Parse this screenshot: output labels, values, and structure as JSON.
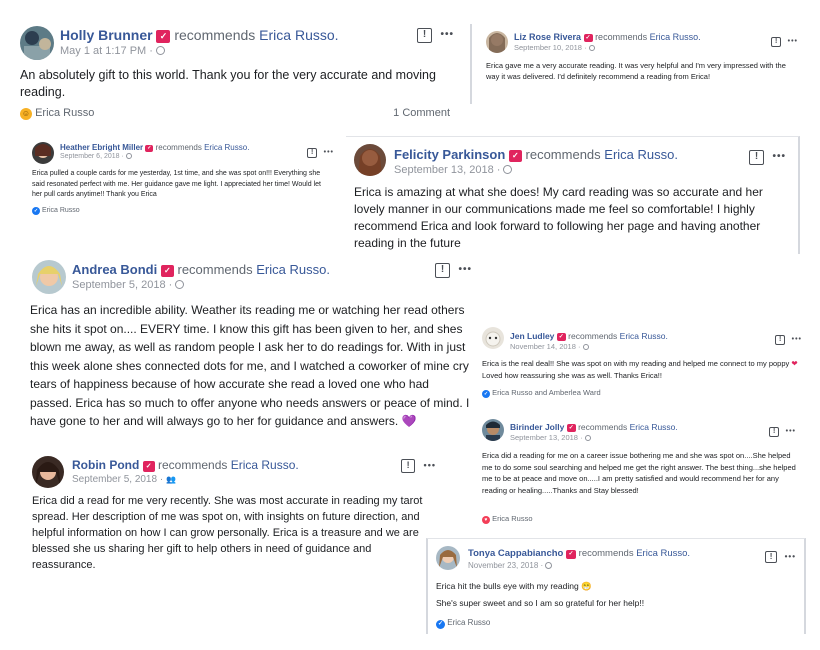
{
  "common": {
    "recommends": "recommends",
    "page_name": "Erica Russo.",
    "badge_icon": "recommendation-badge-icon",
    "flag_glyph": "!",
    "more_glyph": "•••",
    "dot": "·"
  },
  "reviews": {
    "holly": {
      "name": "Holly Brunner",
      "date": "May 1 at 1:17 PM",
      "text": "An absolutely gift to this world. Thank you for the very accurate and moving reading.",
      "reactors": "Erica Russo",
      "comments": "1 Comment"
    },
    "liz": {
      "name": "Liz Rose Rivera",
      "date": "September 10, 2018",
      "text": "Erica gave me a very accurate reading. It was very helpful and I'm very impressed with the way it was delivered. I'd definitely recommend a reading from Erica!"
    },
    "heather": {
      "name": "Heather Ebright Miller",
      "date": "September 6, 2018",
      "text": "Erica pulled a couple cards for me yesterday, 1st time, and she was spot on!!! Everything she said resonated perfect with me. Her guidance gave me light. I appreciated her time! Would let her pull cards anytime!! Thank you Erica",
      "reactors": "Erica Russo"
    },
    "felicity": {
      "name": "Felicity Parkinson",
      "date": "September 13, 2018",
      "text": "Erica is amazing at what she does! My card reading was so accurate and her lovely manner in our communications made me feel so comfortable! I highly recommend Erica and look forward to following her page and having another reading in the future"
    },
    "andrea": {
      "name": "Andrea Bondi",
      "date": "September 5, 2018",
      "text": "Erica has an incredible ability. Weather its reading me or watching her read others she hits it spot on.... EVERY time. I know this gift has been given to her, and shes blown me away, as well as random people I ask her to do readings for. With in just this week alone shes connected dots for me, and I watched a coworker of mine cry tears of happiness because of how accurate she read a loved one who had passed. Erica has so much to offer anyone who needs answers or peace of mind. I have gone to her and will always go to her for guidance and answers.",
      "emoji": "💜"
    },
    "jen": {
      "name": "Jen Ludley",
      "date": "November 14, 2018",
      "text_a": "Erica is the real deal!! She was spot on with my reading and helped me connect to my poppy",
      "emoji": "❤",
      "text_b": "Loved how reassuring she was as well. Thanks Erica!!",
      "reactors": "Erica Russo and Amberlea Ward"
    },
    "birinder": {
      "name": "Birinder Jolly",
      "date": "September 13, 2018",
      "text": "Erica did a reading for me on a career issue bothering me and she was spot on....She helped me to do some soul searching and helped me get the right answer. The best thing...she helped me to be at peace and move on.....I am pretty satisfied and would recommend her for any reading or healing.....Thanks and Stay blessed!",
      "reactors": "Erica Russo"
    },
    "robin": {
      "name": "Robin Pond",
      "date": "September 5, 2018",
      "text": "Erica did a read for me very recently. She was most accurate in reading my tarot spread. Her description of me was spot on, with insights on future direction, and helpful information on how I can grow personally. Erica is a treasure and we are blessed she us sharing her gift to help others in need of guidance and reassurance."
    },
    "tonya": {
      "name": "Tonya Cappabiancho",
      "date": "November 23, 2018",
      "text_a": "Erica hit the bulls eye with my reading",
      "emoji": "😁",
      "text_b": "She's super sweet and so I am so grateful for her help!!",
      "reactors": "Erica Russo"
    }
  },
  "colors": {
    "link": "#385898",
    "badge": "#e0245e",
    "meta": "#90949c",
    "like": "#1877f2",
    "heart": "#f33e58"
  }
}
